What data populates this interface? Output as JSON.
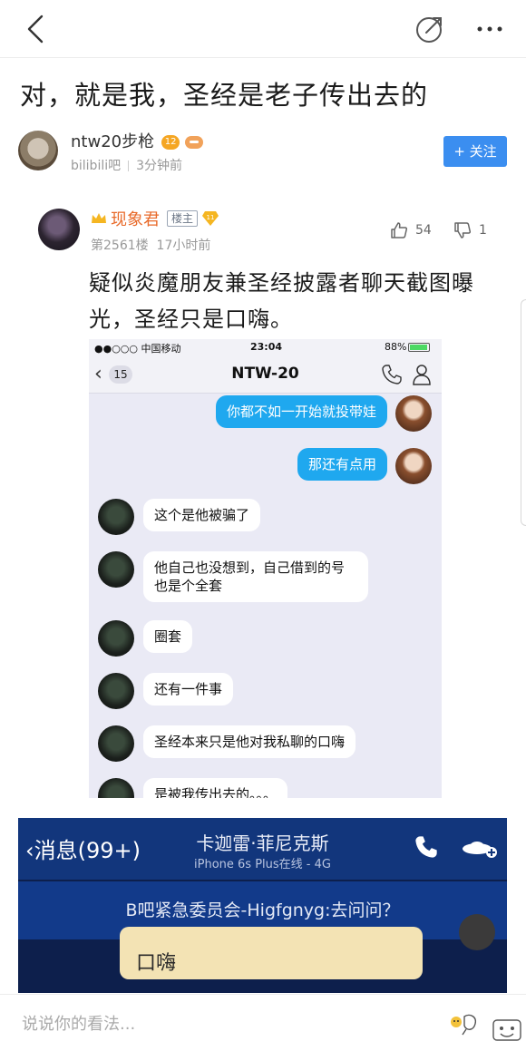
{
  "post": {
    "title": "对，就是我，圣经是老子传出去的",
    "author": {
      "name": "ntw20步枪",
      "level": "12",
      "forum": "bilibili吧",
      "time": "3分钟前"
    },
    "follow_label": "+ 关注"
  },
  "reply": {
    "name": "现象君",
    "op_tag": "楼主",
    "badge_level": "11",
    "floor": "第2561楼",
    "time": "17小时前",
    "likes": "54",
    "dislikes": "1",
    "text": "疑似炎魔朋友兼圣经披露者聊天截图曝光，圣经只是口嗨。"
  },
  "chat_screenshot": {
    "status": {
      "carrier": "●●○○○ 中国移动",
      "time": "23:04",
      "battery": "88%"
    },
    "nav": {
      "back_count": "15",
      "title": "NTW-20"
    },
    "messages": [
      {
        "from": "me",
        "text": "你都不如一开始就投带娃"
      },
      {
        "from": "me",
        "text": "那还有点用"
      },
      {
        "from": "friend",
        "text": "这个是他被骗了"
      },
      {
        "from": "friend",
        "text": "他自己也没想到，自己借到的号也是个全套"
      },
      {
        "from": "friend",
        "text": "圈套"
      },
      {
        "from": "friend",
        "text": "还有一件事"
      },
      {
        "from": "friend",
        "text": "圣经本来只是他对我私聊的口嗨"
      },
      {
        "from": "friend",
        "text": "是被我传出去的。。。"
      }
    ]
  },
  "overlay_screenshot": {
    "back_label": "消息(99+)",
    "title": "卡迦雷·菲尼克斯",
    "subtitle": "iPhone 6s Plus在线 - 4G",
    "banner": "B吧紧急委员会-Higfgnyg:去问问？",
    "bubble_text": "口嗨"
  },
  "bottom": {
    "placeholder": "说说你的看法..."
  },
  "colors": {
    "accent": "#3b8ef0",
    "reply_name": "#e86a2a",
    "bubble_out": "#1fa8ef"
  }
}
